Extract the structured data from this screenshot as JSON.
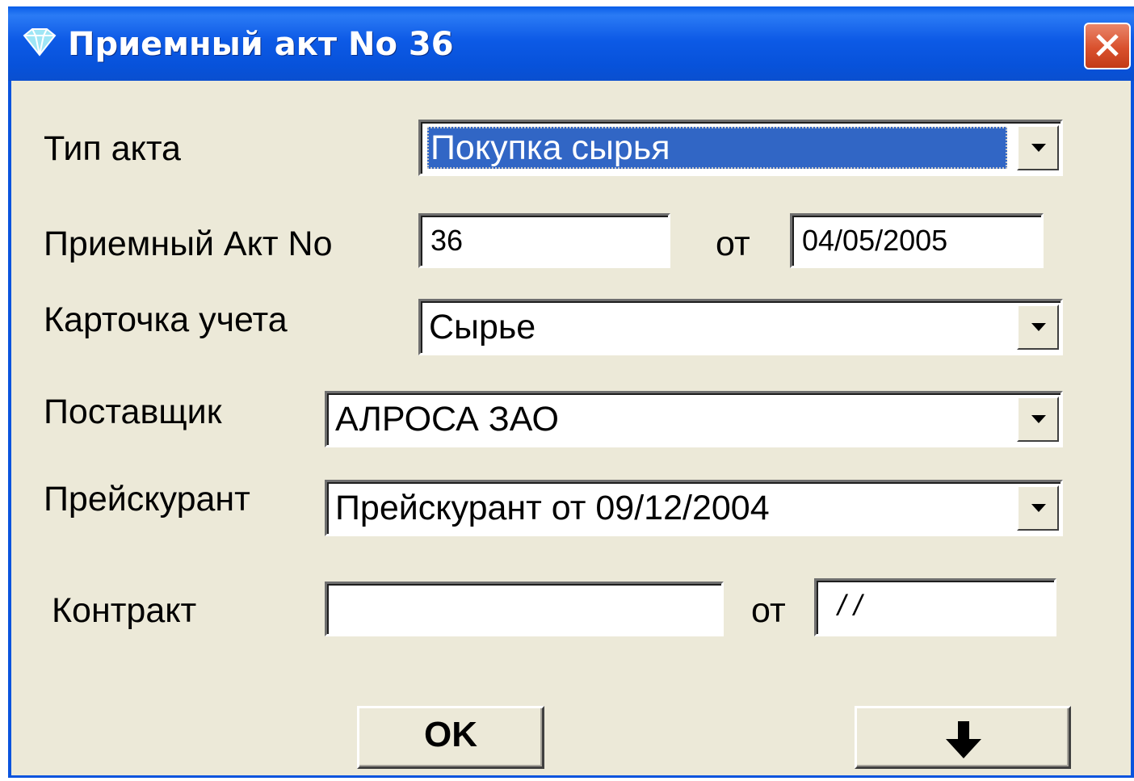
{
  "window": {
    "title": "Приемный акт No 36"
  },
  "form": {
    "act_type": {
      "label": "Тип акта",
      "value": "Покупка сырья"
    },
    "act_number": {
      "label": "Приемный Акт No",
      "value": "36",
      "date_label": "от",
      "date_value": "04/05/2005"
    },
    "account_card": {
      "label": "Карточка учета",
      "value": "Сырье"
    },
    "supplier": {
      "label": "Поставщик",
      "value": "АЛРОСА ЗАО"
    },
    "price_list": {
      "label": "Прейскурант",
      "value": "Прейскурант от 09/12/2004"
    },
    "contract": {
      "label": "Контракт",
      "value": "",
      "date_label": "от",
      "date_value": "/ /"
    }
  },
  "buttons": {
    "ok_label": "OK",
    "down_icon": "arrow-down-icon"
  },
  "colors": {
    "titlebar": "#0a54de",
    "dialog_bg": "#ece9d8",
    "selection": "#3166c5",
    "close": "#d9512e"
  }
}
